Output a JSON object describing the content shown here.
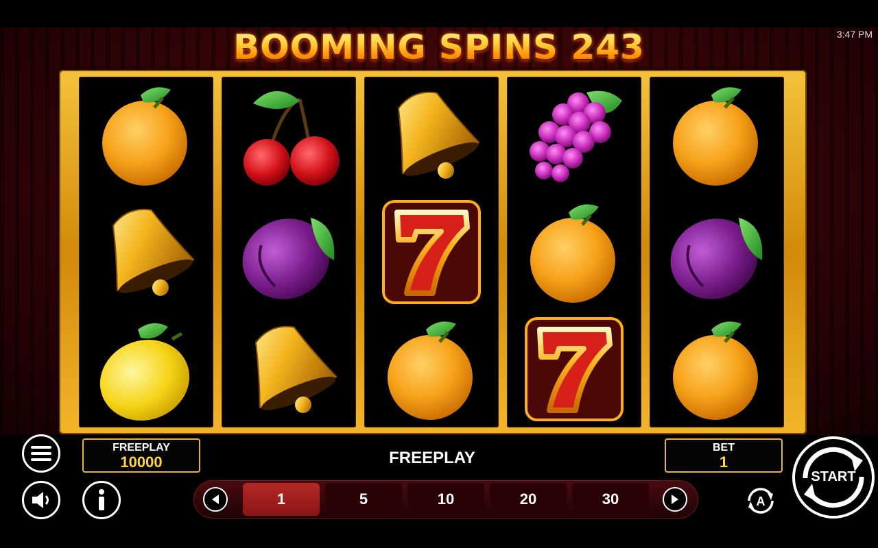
{
  "game": {
    "title": "BOOMING SPINS 243",
    "clock": "3:47 PM"
  },
  "reels": [
    [
      "orange-symbol",
      "bell-symbol",
      "lemon-symbol"
    ],
    [
      "cherry-symbol",
      "plum-symbol",
      "bell-symbol"
    ],
    [
      "bell-symbol",
      "seven-symbol",
      "orange-symbol"
    ],
    [
      "grape-symbol",
      "orange-symbol",
      "seven-symbol"
    ],
    [
      "orange-symbol",
      "plum-symbol",
      "orange-symbol"
    ]
  ],
  "balance": {
    "label": "FREEPLAY",
    "value": "10000"
  },
  "mode_label": "FREEPLAY",
  "bet": {
    "label": "BET",
    "value": "1"
  },
  "bet_options": [
    "1",
    "5",
    "10",
    "20",
    "30"
  ],
  "selected_bet_index": 0,
  "start_label": "START",
  "icons": {
    "menu": "menu-icon",
    "sound": "speaker-icon",
    "info": "info-icon",
    "autoplay": "autoplay-icon",
    "prev": "chevron-left-icon",
    "next": "chevron-right-icon"
  },
  "colors": {
    "frame_gold": "#e9ac22",
    "selected_bet": "#a61f1d",
    "balance_value": "#ffd640"
  }
}
